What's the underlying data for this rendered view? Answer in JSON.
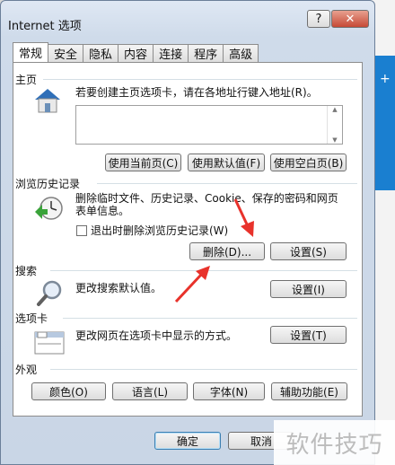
{
  "window": {
    "title": "Internet 选项",
    "help_label": "?",
    "close_label": "✕"
  },
  "tabs": [
    {
      "label": "常规",
      "active": true
    },
    {
      "label": "安全"
    },
    {
      "label": "隐私"
    },
    {
      "label": "内容"
    },
    {
      "label": "连接"
    },
    {
      "label": "程序"
    },
    {
      "label": "高级"
    }
  ],
  "homepage": {
    "group_label": "主页",
    "description": "若要创建主页选项卡，请在各地址行键入地址(R)。",
    "address_value": "",
    "buttons": [
      "使用当前页(C)",
      "使用默认值(F)",
      "使用空白页(B)"
    ],
    "icon": "house-icon"
  },
  "history": {
    "group_label": "浏览历史记录",
    "description_line1": "删除临时文件、历史记录、Cookie、保存的密码和网页",
    "description_line2": "表单信息。",
    "checkbox_label": "退出时删除浏览历史记录(W)",
    "checkbox_checked": false,
    "delete_button": "删除(D)...",
    "settings_button": "设置(S)",
    "icon": "clock-history-icon"
  },
  "search": {
    "group_label": "搜索",
    "description": "更改搜索默认值。",
    "settings_button": "设置(I)",
    "icon": "magnifier-icon"
  },
  "tabsgroup": {
    "group_label": "选项卡",
    "description": "更改网页在选项卡中显示的方式。",
    "settings_button": "设置(T)",
    "icon": "tabs-window-icon"
  },
  "appearance": {
    "group_label": "外观",
    "buttons": [
      "颜色(O)",
      "语言(L)",
      "字体(N)",
      "辅助功能(E)"
    ]
  },
  "footer": {
    "ok_button": "确定",
    "cancel_button": "取消"
  },
  "watermark": "软件技巧",
  "colors": {
    "arrow": "#e8322b",
    "title_bar": "#cfdbea",
    "close": "#c64a36"
  }
}
